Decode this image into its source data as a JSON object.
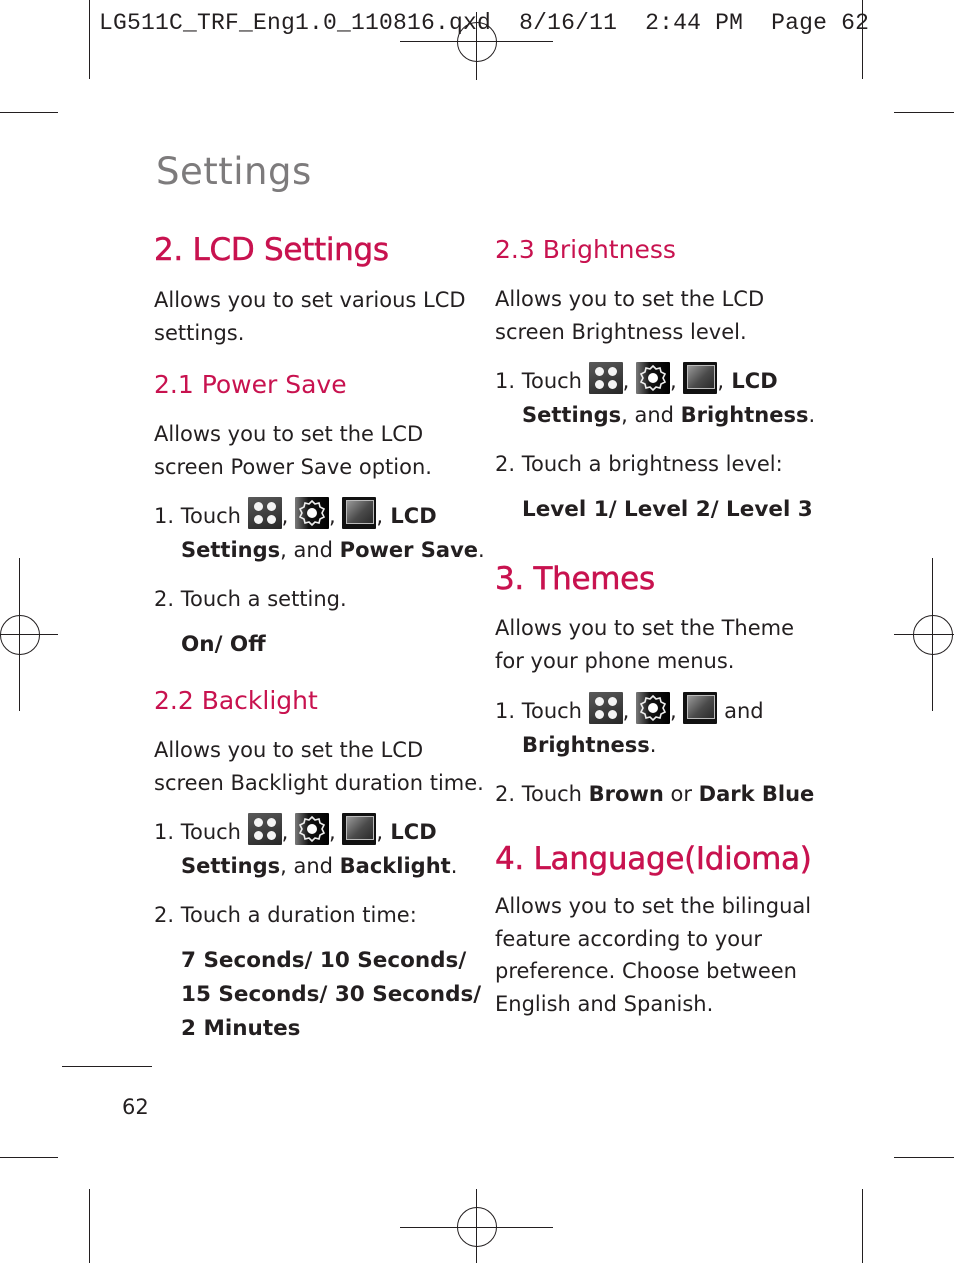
{
  "slug": "LG511C_TRF_Eng1.0_110816.qxd  8/16/11  2:44 PM  Page 62",
  "page_title": "Settings",
  "icons": [
    "apps-grid-icon",
    "settings-gear-icon",
    "display-lcd-icon"
  ],
  "lcd_settings": {
    "heading": "2. LCD Settings",
    "intro": [
      "Allows you to set various LCD",
      "settings."
    ]
  },
  "power_save": {
    "heading": "2.1 Power Save",
    "intro": [
      "Allows you to set the LCD",
      "screen Power Save option."
    ],
    "step1": {
      "prefix": "1. Touch ",
      "sep": ",",
      "after": " LCD",
      "line2_bold1": "Settings",
      "line2_mid": ", and ",
      "line2_bold2": "Power Save",
      "line2_end": "."
    },
    "step2": "2. Touch a setting.",
    "options": "On/ Off"
  },
  "backlight": {
    "heading": "2.2 Backlight",
    "intro": [
      "Allows you to set the LCD",
      "screen Backlight duration time."
    ],
    "step1": {
      "prefix": "1. Touch ",
      "sep": ",",
      "after": " LCD",
      "line2_bold1": "Settings",
      "line2_mid": ", and ",
      "line2_bold2": "Backlight",
      "line2_end": "."
    },
    "step2": "2. Touch a duration time:",
    "options": [
      "7 Seconds/ 10 Seconds/",
      "15 Seconds/ 30 Seconds/",
      "2 Minutes"
    ]
  },
  "brightness": {
    "heading": "2.3 Brightness",
    "intro": [
      "Allows you to set the LCD",
      "screen Brightness level."
    ],
    "step1": {
      "prefix": "1. Touch ",
      "sep": ",",
      "after": " LCD",
      "line2_bold1": "Settings",
      "line2_mid": ", and ",
      "line2_bold2": "Brightness",
      "line2_end": "."
    },
    "step2": "2. Touch a brightness level:",
    "options": "Level 1/ Level 2/ Level 3"
  },
  "themes": {
    "heading": "3. Themes",
    "intro": [
      "Allows you to set the Theme",
      "for your phone menus."
    ],
    "step1": {
      "prefix": "1. Touch ",
      "sep": ",",
      "after": " and",
      "line2_bold": "Brightness",
      "line2_end": "."
    },
    "step2": {
      "prefix": "2. Touch ",
      "bold1": "Brown",
      "mid": " or ",
      "bold2": "Dark Blue"
    }
  },
  "language": {
    "heading": "4. Language(Idioma)",
    "intro": [
      "Allows you to set the bilingual",
      "feature according to your",
      "preference. Choose between",
      "English and Spanish."
    ]
  },
  "page_number": "62"
}
